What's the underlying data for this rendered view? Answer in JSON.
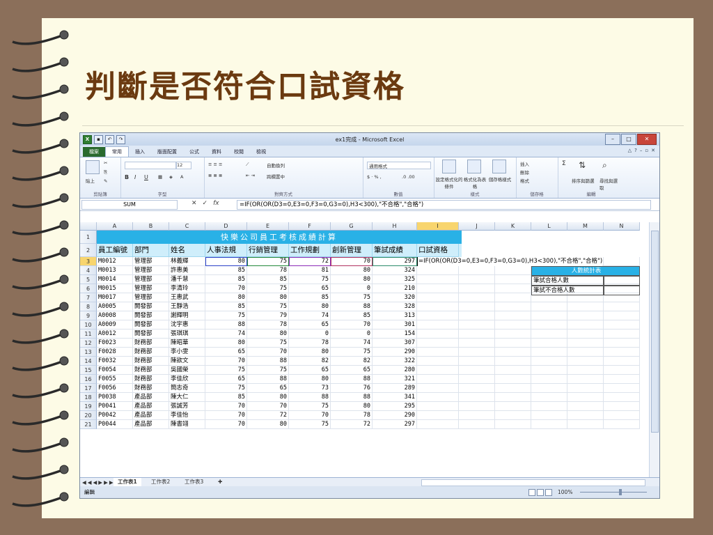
{
  "slide": {
    "title": "判斷是否符合口試資格"
  },
  "window": {
    "title": "ex1完成 - Microsoft Excel",
    "min": "–",
    "max": "□",
    "close": "✕"
  },
  "ribbon": {
    "tabs": [
      "檔案",
      "常用",
      "插入",
      "版面配置",
      "公式",
      "資料",
      "校閱",
      "檢視"
    ],
    "paste": "貼上",
    "font": {
      "name": "",
      "size": "12",
      "bold": "B",
      "italic": "I",
      "underline": "U"
    },
    "wrap": "自動換列",
    "merge": "跨欄置中",
    "number_format": "通用格式",
    "cond_format": "設定格式化的條件",
    "table_format": "格式化為表格",
    "cell_style": "儲存格樣式",
    "insert": "插入",
    "delete": "刪除",
    "format": "格式",
    "sort": "排序與篩選",
    "find": "尋找與選取",
    "groups": [
      "剪貼簿",
      "字型",
      "對齊方式",
      "數值",
      "樣式",
      "儲存格",
      "編輯"
    ]
  },
  "formula_bar": {
    "name_box": "SUM",
    "fx": "fx",
    "formula": "=IF(OR(OR(D3=0,E3=0,F3=0,G3=0),H3<300),\"不合格\",\"合格\")"
  },
  "sheet": {
    "columns": [
      "A",
      "B",
      "C",
      "D",
      "E",
      "F",
      "G",
      "H",
      "I",
      "J",
      "K",
      "L",
      "M",
      "N"
    ],
    "row_numbers": [
      "1",
      "2",
      "3",
      "4",
      "5",
      "6",
      "7",
      "8",
      "9",
      "10",
      "11",
      "12",
      "13",
      "14",
      "15",
      "16",
      "17",
      "18",
      "19",
      "20",
      "21"
    ],
    "banner": "快樂公司員工考核成績計算",
    "headers": [
      "員工編號",
      "部門",
      "姓名",
      "人事法規",
      "行銷管理",
      "工作規劃",
      "創新管理",
      "筆試成績",
      "口試資格"
    ],
    "rows": [
      [
        "M0012",
        "管理部",
        "林義輝",
        "80",
        "75",
        "72",
        "70",
        "297"
      ],
      [
        "M0013",
        "管理部",
        "許惠美",
        "85",
        "78",
        "81",
        "80",
        "324"
      ],
      [
        "M0014",
        "管理部",
        "潘千慧",
        "85",
        "85",
        "75",
        "80",
        "325"
      ],
      [
        "M0015",
        "管理部",
        "李清玲",
        "70",
        "75",
        "65",
        "0",
        "210"
      ],
      [
        "M0017",
        "管理部",
        "王惠武",
        "80",
        "80",
        "85",
        "75",
        "320"
      ],
      [
        "A0005",
        "開發部",
        "王靜浩",
        "85",
        "75",
        "80",
        "88",
        "328"
      ],
      [
        "A0008",
        "開發部",
        "謝輝明",
        "75",
        "79",
        "74",
        "85",
        "313"
      ],
      [
        "A0009",
        "開發部",
        "沈宇惠",
        "88",
        "78",
        "65",
        "70",
        "301"
      ],
      [
        "A0012",
        "開發部",
        "張琪琪",
        "74",
        "80",
        "0",
        "0",
        "154"
      ],
      [
        "F0023",
        "財務部",
        "陳昭華",
        "80",
        "75",
        "78",
        "74",
        "307"
      ],
      [
        "F0028",
        "財務部",
        "李小雯",
        "65",
        "70",
        "80",
        "75",
        "290"
      ],
      [
        "F0032",
        "財務部",
        "陳欲文",
        "70",
        "88",
        "82",
        "82",
        "322"
      ],
      [
        "F0054",
        "財務部",
        "吳國榮",
        "75",
        "75",
        "65",
        "65",
        "280"
      ],
      [
        "F0055",
        "財務部",
        "李佳欣",
        "65",
        "88",
        "80",
        "88",
        "321"
      ],
      [
        "F0056",
        "財務部",
        "簡志奇",
        "75",
        "65",
        "73",
        "76",
        "289"
      ],
      [
        "P0038",
        "產品部",
        "陳大仁",
        "85",
        "80",
        "88",
        "88",
        "341"
      ],
      [
        "P0041",
        "產品部",
        "張誠芳",
        "70",
        "70",
        "75",
        "80",
        "295"
      ],
      [
        "P0042",
        "產品部",
        "李佳怡",
        "70",
        "72",
        "70",
        "78",
        "290"
      ],
      [
        "P0044",
        "產品部",
        "陳書翊",
        "70",
        "80",
        "75",
        "72",
        "297"
      ]
    ],
    "formula_overlay": "=IF(OR(OR(D3=0,E3=0,F3=0,G3=0),H3<300),\"不合格\",\"合格\")",
    "stats": {
      "title": "人數統計表",
      "pass": "筆試合格人數",
      "fail": "筆試不合格人數"
    },
    "sheet_tabs": [
      "工作表1",
      "工作表2",
      "工作表3"
    ]
  },
  "status": {
    "mode": "編輯",
    "zoom": "100%"
  }
}
